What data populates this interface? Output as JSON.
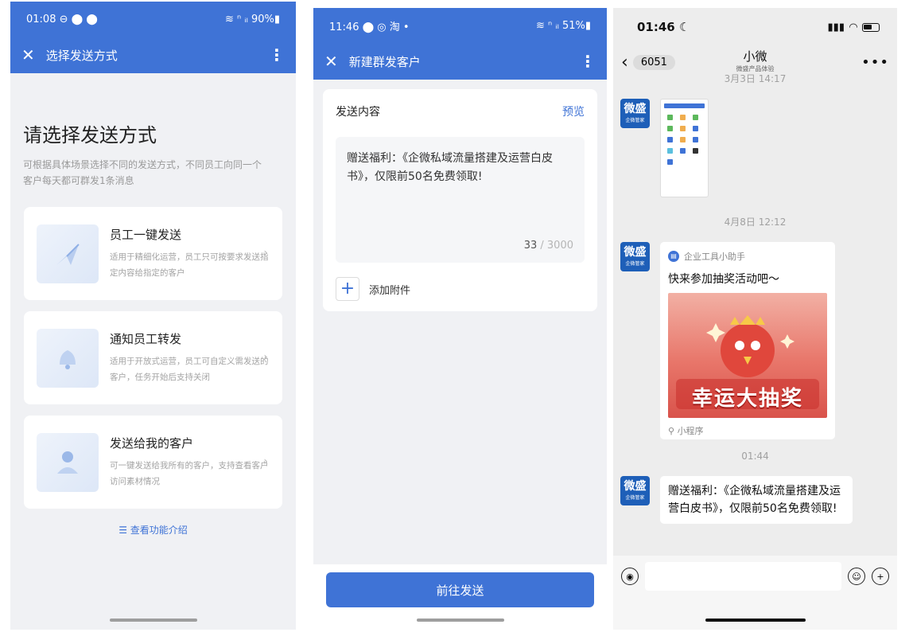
{
  "screen1": {
    "status_time": "01:08 ⊖ ⬤ ⬤",
    "status_right": "≋ ⁿ ᵢₗ 90%▮",
    "title": "选择发送方式",
    "heading": "请选择发送方式",
    "description": "可根据具体场景选择不同的发送方式，不同员工向同一个客户每天都可群发1条消息",
    "options": [
      {
        "title": "员工一键发送",
        "desc": "适用于精细化运营，员工只可按要求发送指定内容给指定的客户"
      },
      {
        "title": "通知员工转发",
        "desc": "适用于开放式运营，员工可自定义需发送的客户，任务开始后支持关闭"
      },
      {
        "title": "发送给我的客户",
        "desc": "可一键发送给我所有的客户，支持查看客户访问素材情况"
      }
    ],
    "link": "☰ 查看功能介绍",
    "colors": {
      "primary": "#3f73d6"
    }
  },
  "screen2": {
    "status_time": "11:46 ⬤ ◎ 淘 •",
    "status_right": "≋ ⁿ ᵢₗ 51%▮",
    "title": "新建群发客户",
    "content_label": "发送内容",
    "preview": "预览",
    "message": "赠送福利：《企微私域流量搭建及运营白皮书》，仅限前50名免费领取!",
    "count": "33",
    "max": " / 3000",
    "attach": "添加附件",
    "submit": "前往发送"
  },
  "screen3": {
    "time": "01:46",
    "back_count": "6051",
    "chat_name": "小微",
    "chat_sub": "微盛产品体验",
    "top_time": "3月3日 14:17",
    "avatar_main": "微盛",
    "avatar_sub": "企微管家",
    "time2": "4月8日 12:12",
    "mp_source": "企业工具小助手",
    "mp_title": "快来参加抽奖活动吧～",
    "mp_banner": "幸运大抽奖",
    "mp_footer": "小程序",
    "time3": "01:44",
    "text_message": "赠送福利：《企微私域流量搭建及运营白皮书》，仅限前50名免费领取!"
  }
}
